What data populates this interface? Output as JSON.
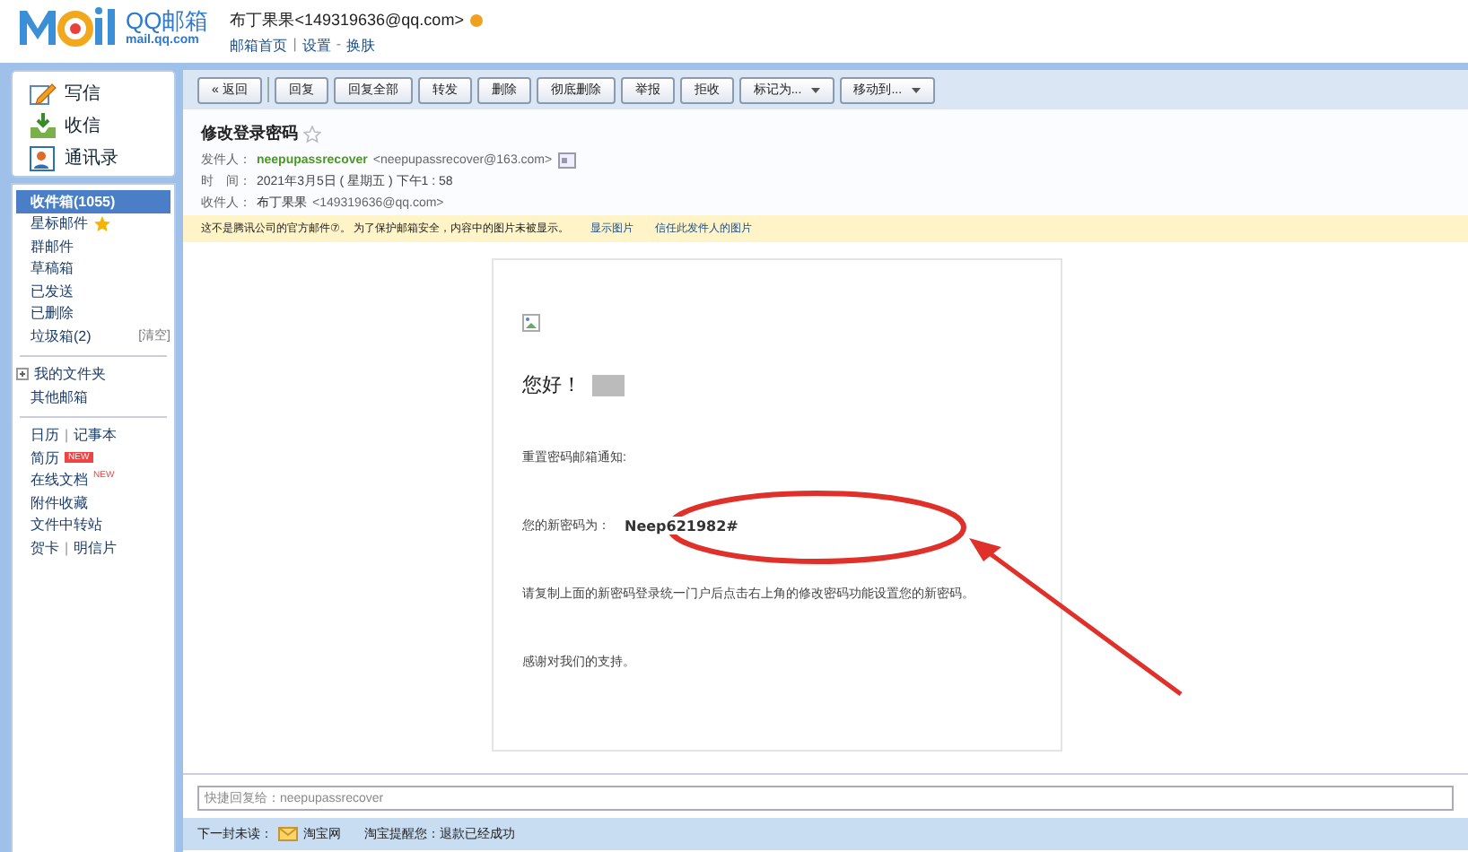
{
  "header": {
    "logo_text": "QQ邮箱",
    "logo_domain": "mail.qq.com",
    "account": "布丁果果<149319636@qq.com>",
    "links": [
      {
        "label": "邮箱首页"
      },
      {
        "sep": "|",
        "label": "设置"
      },
      {
        "sep": "-",
        "label": "换肤"
      }
    ]
  },
  "quick_actions": [
    {
      "label": "写信",
      "kind": "write"
    },
    {
      "label": "收信",
      "kind": "receive"
    },
    {
      "label": "通讯录",
      "kind": "contacts"
    }
  ],
  "folders": [
    {
      "label": "收件箱(1055)",
      "selected": true,
      "starred": false
    },
    {
      "label": "星标邮件",
      "selected": false,
      "starred": true
    },
    {
      "label": "群邮件",
      "selected": false,
      "starred": false
    },
    {
      "label": "草稿箱",
      "selected": false,
      "starred": false
    },
    {
      "label": "已发送",
      "selected": false,
      "starred": false
    },
    {
      "label": "已删除",
      "selected": false,
      "starred": false
    },
    {
      "label": "垃圾箱(2)",
      "selected": false,
      "starred": false,
      "action": "[清空]"
    }
  ],
  "my_folders": {
    "label": "我的文件夹",
    "expanded": false
  },
  "other_mailbox": "其他邮箱",
  "apps": [
    [
      {
        "label": "日历"
      },
      {
        "sep": "|",
        "label": "记事本"
      }
    ],
    [
      {
        "label": "简历",
        "badge": "NEW",
        "kind": "box"
      }
    ],
    [
      {
        "label": "在线文档",
        "badge": "NEW",
        "kind": "sup"
      }
    ],
    [
      {
        "label": "附件收藏"
      }
    ],
    [
      {
        "label": "文件中转站"
      }
    ],
    [
      {
        "label": "贺卡"
      },
      {
        "sep": "|",
        "label": "明信片"
      }
    ]
  ],
  "toolbar": [
    {
      "label": "« 返回",
      "dropdown": false,
      "divider_after": true
    },
    {
      "label": "回复",
      "dropdown": false,
      "divider_after": false
    },
    {
      "label": "回复全部",
      "dropdown": false,
      "divider_after": false
    },
    {
      "label": "转发",
      "dropdown": false,
      "divider_after": false
    },
    {
      "label": "删除",
      "dropdown": false,
      "divider_after": false
    },
    {
      "label": "彻底删除",
      "dropdown": false,
      "divider_after": false
    },
    {
      "label": "举报",
      "dropdown": false,
      "divider_after": false
    },
    {
      "label": "拒收",
      "dropdown": false,
      "divider_after": false
    },
    {
      "label": "标记为...",
      "dropdown": true,
      "divider_after": false
    },
    {
      "label": "移动到...",
      "dropdown": true,
      "divider_after": false
    }
  ],
  "email": {
    "subject": "修改登录密码",
    "starred": false,
    "meta": [
      {
        "label": "发件人：",
        "name": "neepupassrecover",
        "address": "<neepupassrecover@163.com>",
        "kind": "sender"
      },
      {
        "label": "时　间：",
        "value": "2021年3月5日 ( 星期五 ) 下午1 : 58",
        "kind": "time"
      },
      {
        "label": "收件人：",
        "name": "布丁果果",
        "address": "<149319636@qq.com>",
        "kind": "recipient"
      }
    ],
    "notice": {
      "text": "这不是腾讯公司的官方邮件⑦。 为了保护邮箱安全，内容中的图片未被显示。",
      "links": [
        "显示图片",
        "信任此发件人的图片"
      ]
    },
    "body": {
      "greeting": "您好！",
      "name_redacted": true,
      "lines": [
        "重置密码邮箱通知:",
        "请复制上面的新密码登录统一门户后点击右上角的修改密码功能设置您的新密码。",
        "感谢对我们的支持。"
      ],
      "password_label": "您的新密码为：",
      "password": "Neep621982#"
    }
  },
  "quick_reply": {
    "placeholder": "快捷回复给：neepupassrecover"
  },
  "next_unread": {
    "label": "下一封未读：",
    "sender": "淘宝网",
    "subject": "淘宝提醒您：退款已经成功"
  }
}
